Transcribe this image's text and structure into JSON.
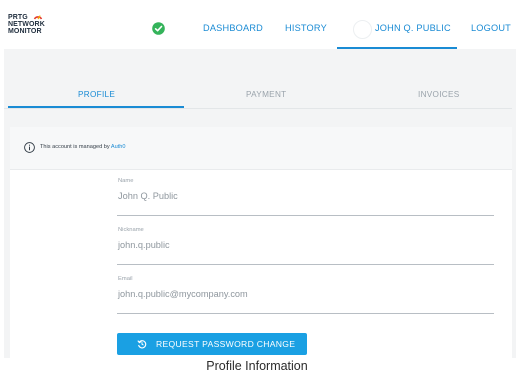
{
  "brand": {
    "logo_lines": [
      "PRTG",
      "NETWORK",
      "MONITOR"
    ],
    "icon": "prtg-arc-logo",
    "colors": {
      "arc_red": "#e23b2e",
      "arc_yellow": "#f4b400",
      "text": "#1f2d3d"
    }
  },
  "header": {
    "status_icon": "check-circle-icon",
    "status_color": "#34b35a",
    "nav": {
      "dashboard": "DASHBOARD",
      "history": "HISTORY",
      "user": "JOHN Q. PUBLIC",
      "logout": "LOGOUT"
    },
    "accent": "#1a8bd4"
  },
  "tabs": [
    {
      "label": "PROFILE",
      "active": true
    },
    {
      "label": "PAYMENT",
      "active": false
    },
    {
      "label": "INVOICES",
      "active": false
    }
  ],
  "notice": {
    "icon": "info-icon",
    "text": "This account is managed by",
    "link": "Auth0"
  },
  "form": {
    "fields": [
      {
        "label": "Name",
        "value": "John Q. Public"
      },
      {
        "label": "Nickname",
        "value": "john.q.public"
      },
      {
        "label": "Email",
        "value": "john.q.public@mycompany.com"
      }
    ],
    "reset_button": {
      "icon": "history-reset-icon",
      "label": "REQUEST PASSWORD CHANGE",
      "color": "#1aa0e3"
    }
  },
  "caption": "Profile Information"
}
